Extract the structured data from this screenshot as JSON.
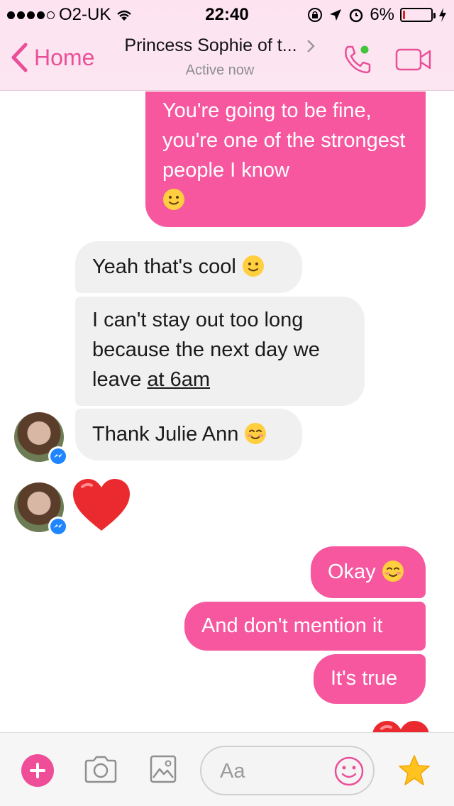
{
  "status_bar": {
    "carrier": "O2-UK",
    "time": "22:40",
    "battery": "6%",
    "battery_level": 0.06
  },
  "header": {
    "back_label": "Home",
    "contact_name": "Princess Sophie of t...",
    "presence": "Active now",
    "accent_color": "#ea4f98"
  },
  "messages": [
    {
      "direction": "out",
      "text": "You're going to be fine, you're one of the strongest people I know",
      "emoji": "slightly-smiling-emoji"
    },
    {
      "direction": "in",
      "text": "Yeah that's cool",
      "emoji": "slightly-smiling-emoji"
    },
    {
      "direction": "in",
      "text_before": "I can't stay out too long because the next day we leave ",
      "link": "at 6am"
    },
    {
      "direction": "in",
      "text": "Thank Julie Ann",
      "emoji": "blushing-smile-emoji"
    },
    {
      "direction": "in",
      "emoji": "red-heart-emoji"
    },
    {
      "direction": "out",
      "text": "Okay",
      "emoji": "blushing-smile-emoji"
    },
    {
      "direction": "out",
      "text": "And don't mention it"
    },
    {
      "direction": "out",
      "text": "It's true"
    },
    {
      "direction": "out",
      "emoji": "red-heart-emoji"
    }
  ],
  "composer": {
    "placeholder": "Aa"
  }
}
